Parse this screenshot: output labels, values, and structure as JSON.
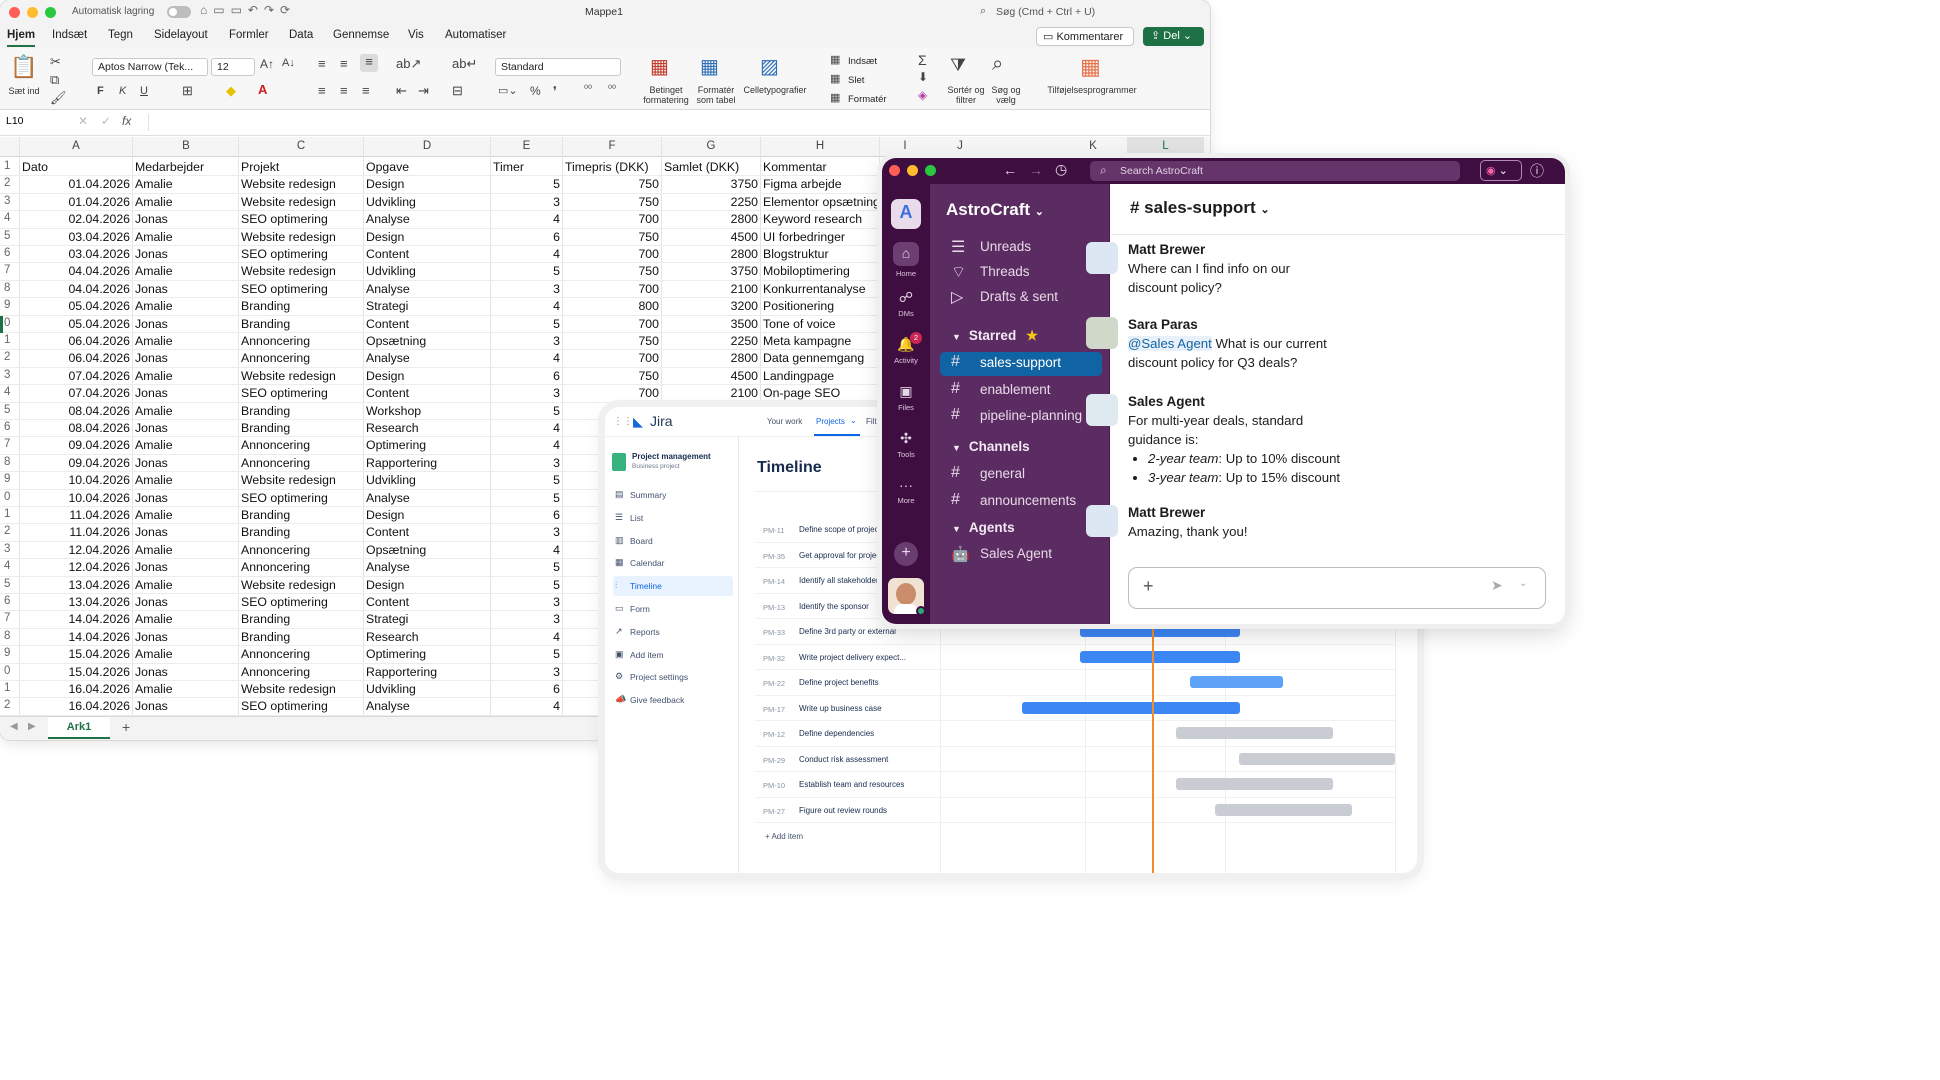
{
  "excel": {
    "autosave_label": "Automatisk lagring",
    "title": "Mappe1",
    "search_placeholder": "Søg (Cmd + Ctrl + U)",
    "tabs": [
      "Hjem",
      "Indsæt",
      "Tegn",
      "Sidelayout",
      "Formler",
      "Data",
      "Gennemse",
      "Vis",
      "Automatiser"
    ],
    "comments_button": "Kommentarer",
    "share_button": "Del",
    "ribbon": {
      "paste": "Sæt ind",
      "font_name": "Aptos Narrow (Tek...",
      "font_size": "12",
      "bold": "F",
      "italic": "K",
      "underline": "U",
      "number_format": "Standard",
      "cond_format": "Betinget formatering",
      "format_table": "Formatér som tabel",
      "cell_styles": "Celletypografier",
      "insert": "Indsæt",
      "delete": "Slet",
      "format": "Formatér",
      "sort_filter": "Sortér og filtrer",
      "find_select": "Søg og vælg",
      "addins": "Tilføjelsesprogrammer"
    },
    "name_box": "L10",
    "fx": "fx",
    "columns": [
      "A",
      "B",
      "C",
      "D",
      "E",
      "F",
      "G",
      "H",
      "I",
      "J",
      "K",
      "L"
    ],
    "headers": [
      "Dato",
      "Medarbejder",
      "Projekt",
      "Opgave",
      "Timer",
      "Timepris (DKK)",
      "Samlet (DKK)",
      "Kommentar"
    ],
    "row_numbers": [
      "1",
      "2",
      "3",
      "4",
      "5",
      "6",
      "7",
      "8",
      "9",
      "0",
      "1",
      "2",
      "3",
      "4",
      "5",
      "6",
      "7",
      "8",
      "9",
      "0",
      "1",
      "2",
      "3",
      "4",
      "5",
      "6",
      "7",
      "8",
      "9",
      "0",
      "1",
      "2"
    ],
    "rows": [
      [
        "01.04.2026",
        "Amalie",
        "Website redesign",
        "Design",
        "5",
        "750",
        "3750",
        "Figma arbejde"
      ],
      [
        "01.04.2026",
        "Amalie",
        "Website redesign",
        "Udvikling",
        "3",
        "750",
        "2250",
        "Elementor opsætning"
      ],
      [
        "02.04.2026",
        "Jonas",
        "SEO optimering",
        "Analyse",
        "4",
        "700",
        "2800",
        "Keyword research"
      ],
      [
        "03.04.2026",
        "Amalie",
        "Website redesign",
        "Design",
        "6",
        "750",
        "4500",
        "UI forbedringer"
      ],
      [
        "03.04.2026",
        "Jonas",
        "SEO optimering",
        "Content",
        "4",
        "700",
        "2800",
        "Blogstruktur"
      ],
      [
        "04.04.2026",
        "Amalie",
        "Website redesign",
        "Udvikling",
        "5",
        "750",
        "3750",
        "Mobiloptimering"
      ],
      [
        "04.04.2026",
        "Jonas",
        "SEO optimering",
        "Analyse",
        "3",
        "700",
        "2100",
        "Konkurrentanalyse"
      ],
      [
        "05.04.2026",
        "Amalie",
        "Branding",
        "Strategi",
        "4",
        "800",
        "3200",
        "Positionering"
      ],
      [
        "05.04.2026",
        "Jonas",
        "Branding",
        "Content",
        "5",
        "700",
        "3500",
        "Tone of voice"
      ],
      [
        "06.04.2026",
        "Amalie",
        "Annoncering",
        "Opsætning",
        "3",
        "750",
        "2250",
        "Meta kampagne"
      ],
      [
        "06.04.2026",
        "Jonas",
        "Annoncering",
        "Analyse",
        "4",
        "700",
        "2800",
        "Data gennemgang"
      ],
      [
        "07.04.2026",
        "Amalie",
        "Website redesign",
        "Design",
        "6",
        "750",
        "4500",
        "Landingpage"
      ],
      [
        "07.04.2026",
        "Jonas",
        "SEO optimering",
        "Content",
        "3",
        "700",
        "2100",
        "On-page SEO"
      ],
      [
        "08.04.2026",
        "Amalie",
        "Branding",
        "Workshop",
        "5",
        "",
        "",
        ""
      ],
      [
        "08.04.2026",
        "Jonas",
        "Branding",
        "Research",
        "4",
        "",
        "",
        ""
      ],
      [
        "09.04.2026",
        "Amalie",
        "Annoncering",
        "Optimering",
        "4",
        "",
        "",
        ""
      ],
      [
        "09.04.2026",
        "Jonas",
        "Annoncering",
        "Rapportering",
        "3",
        "",
        "",
        ""
      ],
      [
        "10.04.2026",
        "Amalie",
        "Website redesign",
        "Udvikling",
        "5",
        "",
        "",
        ""
      ],
      [
        "10.04.2026",
        "Jonas",
        "SEO optimering",
        "Analyse",
        "5",
        "",
        "",
        ""
      ],
      [
        "11.04.2026",
        "Amalie",
        "Branding",
        "Design",
        "6",
        "",
        "",
        ""
      ],
      [
        "11.04.2026",
        "Jonas",
        "Branding",
        "Content",
        "3",
        "",
        "",
        ""
      ],
      [
        "12.04.2026",
        "Amalie",
        "Annoncering",
        "Opsætning",
        "4",
        "",
        "",
        ""
      ],
      [
        "12.04.2026",
        "Jonas",
        "Annoncering",
        "Analyse",
        "5",
        "",
        "",
        ""
      ],
      [
        "13.04.2026",
        "Amalie",
        "Website redesign",
        "Design",
        "5",
        "",
        "",
        ""
      ],
      [
        "13.04.2026",
        "Jonas",
        "SEO optimering",
        "Content",
        "3",
        "",
        "",
        ""
      ],
      [
        "14.04.2026",
        "Amalie",
        "Branding",
        "Strategi",
        "3",
        "",
        "",
        ""
      ],
      [
        "14.04.2026",
        "Jonas",
        "Branding",
        "Research",
        "4",
        "",
        "",
        ""
      ],
      [
        "15.04.2026",
        "Amalie",
        "Annoncering",
        "Optimering",
        "5",
        "",
        "",
        ""
      ],
      [
        "15.04.2026",
        "Jonas",
        "Annoncering",
        "Rapportering",
        "3",
        "",
        "",
        ""
      ],
      [
        "16.04.2026",
        "Amalie",
        "Website redesign",
        "Udvikling",
        "6",
        "",
        "",
        ""
      ],
      [
        "16.04.2026",
        "Jonas",
        "SEO optimering",
        "Analyse",
        "4",
        "",
        "",
        ""
      ]
    ],
    "sheet_tab": "Ark1",
    "add_sheet": "+"
  },
  "jira": {
    "logo_text": "Jira",
    "top_nav": [
      "Your work",
      "Projects",
      "Filt"
    ],
    "project_name": "Project management",
    "project_type": "Business project",
    "nav_items": [
      {
        "label": "Summary",
        "icon": "summary-icon"
      },
      {
        "label": "List",
        "icon": "list-icon"
      },
      {
        "label": "Board",
        "icon": "board-icon"
      },
      {
        "label": "Calendar",
        "icon": "calendar-icon"
      },
      {
        "label": "Timeline",
        "icon": "timeline-icon"
      },
      {
        "label": "Form",
        "icon": "form-icon"
      },
      {
        "label": "Reports",
        "icon": "reports-icon"
      },
      {
        "label": "Add item",
        "icon": "add-icon"
      },
      {
        "label": "Project settings",
        "icon": "settings-icon"
      },
      {
        "label": "Give feedback",
        "icon": "feedback-icon"
      }
    ],
    "selected_nav": "Timeline",
    "page_title": "Timeline",
    "items": [
      {
        "key": "PM-11",
        "summary": "Define scope of project"
      },
      {
        "key": "PM-35",
        "summary": "Get approval for project"
      },
      {
        "key": "PM-14",
        "summary": "Identify all stakeholders"
      },
      {
        "key": "PM-13",
        "summary": "Identify the sponsor"
      },
      {
        "key": "PM-33",
        "summary": "Define 3rd party or external"
      },
      {
        "key": "PM-32",
        "summary": "Write project delivery expect..."
      },
      {
        "key": "PM-22",
        "summary": "Define project benefits"
      },
      {
        "key": "PM-17",
        "summary": "Write up business case"
      },
      {
        "key": "PM-12",
        "summary": "Define dependencies"
      },
      {
        "key": "PM-29",
        "summary": "Conduct risk assessment"
      },
      {
        "key": "PM-10",
        "summary": "Establish team and resources"
      },
      {
        "key": "PM-27",
        "summary": "Figure out review rounds"
      }
    ],
    "add_item": "+ Add item",
    "colors": {
      "bar_blue": "#3d87f5",
      "bar_light": "#5ea2f7",
      "bar_grey": "#c9ccd3",
      "today_line": "#f28c28"
    }
  },
  "slack": {
    "search_placeholder": "Search AstroCraft",
    "workspace": "AstroCraft",
    "rail": [
      {
        "label": "Home",
        "icon": "home-icon"
      },
      {
        "label": "DMs",
        "icon": "dms-icon"
      },
      {
        "label": "Activity",
        "icon": "activity-icon",
        "badge": "2"
      },
      {
        "label": "Files",
        "icon": "files-icon"
      },
      {
        "label": "Tools",
        "icon": "tools-icon"
      },
      {
        "label": "More",
        "icon": "more-icon"
      }
    ],
    "top_items": [
      {
        "label": "Unreads",
        "icon": "unreads-icon"
      },
      {
        "label": "Threads",
        "icon": "threads-icon"
      },
      {
        "label": "Drafts & sent",
        "icon": "send-icon"
      }
    ],
    "sections": {
      "starred": "Starred",
      "channels": "Channels",
      "agents": "Agents"
    },
    "starred_channels": [
      "sales-support",
      "enablement",
      "pipeline-planning"
    ],
    "channels": [
      "general",
      "announcements"
    ],
    "agents": [
      "Sales Agent"
    ],
    "current_channel": "# sales-support",
    "messages": [
      {
        "name": "Matt Brewer",
        "text": "Where can I find info on our discount policy?"
      },
      {
        "name": "Sara Paras",
        "mention": "@Sales Agent",
        "text": " What is our current discount policy for Q3 deals?"
      },
      {
        "name": "Sales Agent",
        "text": "For multi-year deals, standard guidance is:",
        "bullets": [
          {
            "term": "2-year team",
            "rest": ": Up to 10% discount"
          },
          {
            "term": "3-year team",
            "rest": ": Up to 15% discount"
          }
        ]
      },
      {
        "name": "Matt Brewer",
        "text": "Amazing, thank you!"
      }
    ],
    "colors": {
      "aubergine": "#3f0e40",
      "sidebar": "#5b2c61",
      "selected": "#1164a3",
      "mention": "#1264a3"
    }
  }
}
